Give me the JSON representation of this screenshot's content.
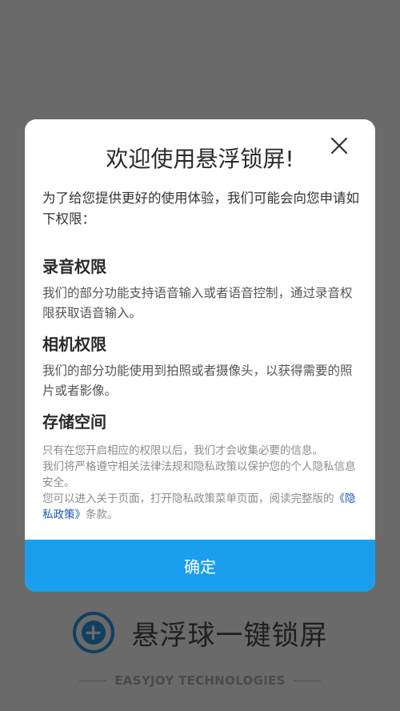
{
  "background": {
    "brand_name": "悬浮球一键锁屏",
    "company": "EASYJOY TECHNOLOGIES"
  },
  "dialog": {
    "title": "欢迎使用悬浮锁屏!",
    "close_icon": "close-icon",
    "intro": "为了给您提供更好的使用体验，我们可能会向您申请如下权限：",
    "permissions": [
      {
        "title": "录音权限",
        "description": "我们的部分功能支持语音输入或者语音控制，通过录音权限获取语音输入。"
      },
      {
        "title": "相机权限",
        "description": "我们的部分功能使用到拍照或者摄像头，以获得需要的照片或者影像。"
      },
      {
        "title": "存储空间",
        "description": ""
      }
    ],
    "notes": {
      "line1": "只有在您开启相应的权限以后，我们才会收集必要的信息。",
      "line2": "我们将严格遵守相关法律法规和隐私政策以保护您的个人隐私信息安全。",
      "line3": "您可以进入关于页面，打开隐私政策菜单页面，阅读完整版的",
      "policy_link": "《隐私政策》",
      "line3_end": "条款。"
    },
    "confirm_label": "确定"
  },
  "colors": {
    "accent": "#1a9fee",
    "link": "#1a56b8",
    "overlay": "#6a6a6a"
  }
}
